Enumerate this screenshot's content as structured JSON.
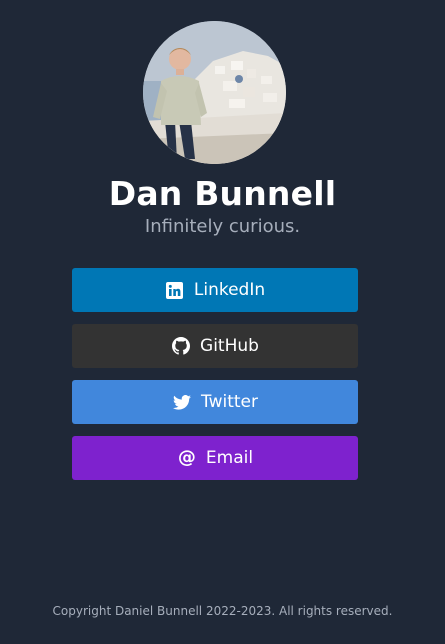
{
  "profile": {
    "name": "Dan Bunnell",
    "tagline": "Infinitely curious."
  },
  "links": [
    {
      "label": "LinkedIn",
      "icon": "linkedin-icon",
      "color": "#0077b5"
    },
    {
      "label": "GitHub",
      "icon": "github-icon",
      "color": "#333333"
    },
    {
      "label": "Twitter",
      "icon": "twitter-icon",
      "color": "#4187dc"
    },
    {
      "label": "Email",
      "icon": "at-icon",
      "color": "#7e22ce"
    }
  ],
  "footer": {
    "text": "Copyright Daniel Bunnell 2022-2023. All rights reserved."
  },
  "theme": {
    "background": "#1f2837",
    "muted_text": "#a6aebb"
  }
}
